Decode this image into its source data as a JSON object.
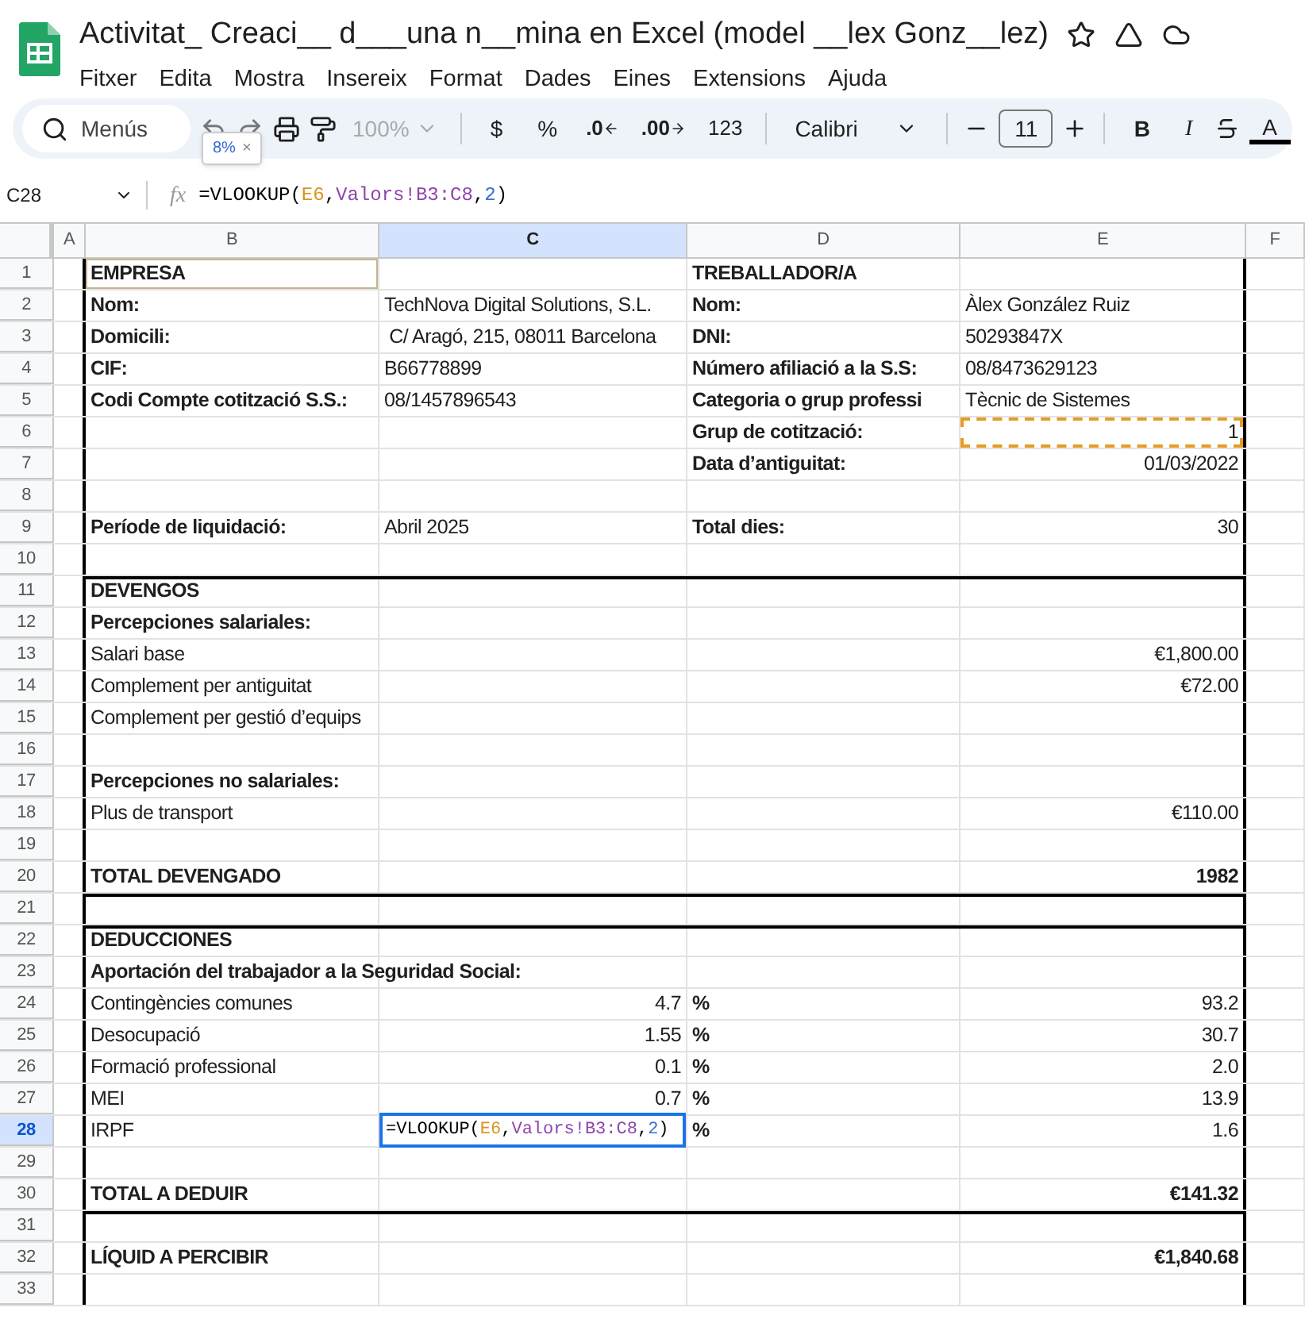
{
  "app": {
    "title": "Activitat_ Creaci__ d___una n__mina en Excel (model __lex Gonz__lez)",
    "menus": [
      "Fitxer",
      "Edita",
      "Mostra",
      "Insereix",
      "Format",
      "Dades",
      "Eines",
      "Extensions",
      "Ajuda"
    ]
  },
  "toolbar": {
    "search": "Menús",
    "zoom": "100%",
    "currency": "$",
    "percent": "%",
    "decrease_decimals": ".0",
    "increase_decimals": ".00",
    "number_format": "123",
    "font": "Calibri",
    "font_size": "11",
    "bold": "B",
    "italic": "I",
    "text_color": "A"
  },
  "tooltip": {
    "text": "8%",
    "close": "×"
  },
  "formula_bar": {
    "cell": "C28",
    "fx": "fx",
    "formula": [
      {
        "text": "=VLOOKUP(",
        "color": "#000000"
      },
      {
        "text": "E6",
        "color": "#d9951e"
      },
      {
        "text": ",",
        "color": "#000000"
      },
      {
        "text": "Valors!B3:C8",
        "color": "#8e44ad"
      },
      {
        "text": ",",
        "color": "#000000"
      },
      {
        "text": "2",
        "color": "#3b6fd4"
      },
      {
        "text": ")",
        "color": "#000000"
      }
    ]
  },
  "sheet": {
    "columns": [
      {
        "label": "A",
        "selected": false
      },
      {
        "label": "B",
        "selected": false
      },
      {
        "label": "C",
        "selected": true
      },
      {
        "label": "D",
        "selected": false
      },
      {
        "label": "E",
        "selected": false
      },
      {
        "label": "F",
        "selected": false
      }
    ],
    "rows": [
      {
        "number": "1",
        "selected": false,
        "rule_above": false,
        "cells": [
          {
            "text": ""
          },
          {
            "kind": "text",
            "text": "EMPRESA",
            "bold": true,
            "outlined": true
          },
          {
            "text": ""
          },
          {
            "kind": "text",
            "text": "TREBALLADOR/A",
            "bold": true
          }
        ]
      },
      {
        "number": "2",
        "selected": false,
        "rule_above": false,
        "cells": [
          {
            "text": ""
          },
          {
            "kind": "text",
            "text": "Nom:",
            "bold": true
          },
          {
            "kind": "text",
            "text": "TechNova Digital Solutions, S.L.",
            "bold": false
          },
          {
            "kind": "text",
            "text": "Nom:",
            "bold": true
          },
          {
            "kind": "text",
            "text": "Àlex González Ruiz",
            "bold": false
          }
        ]
      },
      {
        "number": "3",
        "selected": false,
        "rule_above": false,
        "cells": [
          {
            "text": ""
          },
          {
            "kind": "text",
            "text": "Domicili:",
            "bold": true
          },
          {
            "kind": "text",
            "text": " C/ Aragó, 215, 08011 Barcelona",
            "bold": false
          },
          {
            "kind": "text",
            "text": "DNI:",
            "bold": true
          },
          {
            "kind": "text",
            "text": "50293847X",
            "bold": false
          }
        ]
      },
      {
        "number": "4",
        "selected": false,
        "rule_above": false,
        "cells": [
          {
            "text": ""
          },
          {
            "kind": "text",
            "text": "CIF:",
            "bold": true
          },
          {
            "kind": "text",
            "text": "B66778899",
            "bold": false
          },
          {
            "kind": "text",
            "text": "Número afiliació a la S.S:",
            "bold": true
          },
          {
            "kind": "text",
            "text": "08/8473629123",
            "bold": false
          }
        ]
      },
      {
        "number": "5",
        "selected": false,
        "rule_above": false,
        "cells": [
          {
            "text": ""
          },
          {
            "kind": "text",
            "text": "Codi Compte cotització S.S.:",
            "bold": true
          },
          {
            "kind": "text",
            "text": "08/1457896543",
            "bold": false
          },
          {
            "kind": "text",
            "text": "Categoria o grup professi",
            "bold": true
          },
          {
            "kind": "text",
            "text": "Tècnic de Sistemes",
            "bold": false
          }
        ]
      },
      {
        "number": "6",
        "selected": false,
        "rule_above": false,
        "cells": [
          {
            "text": ""
          },
          {
            "text": ""
          },
          {
            "text": ""
          },
          {
            "kind": "text",
            "text": "Grup de cotització:",
            "bold": true
          },
          {
            "kind": "number",
            "text": "1",
            "bold": false,
            "referenced": true
          }
        ]
      },
      {
        "number": "7",
        "selected": false,
        "rule_above": false,
        "cells": [
          {
            "text": ""
          },
          {
            "text": ""
          },
          {
            "text": ""
          },
          {
            "kind": "text",
            "text": "Data d’antiguitat:",
            "bold": true
          },
          {
            "kind": "number",
            "text": "01/03/2022",
            "bold": false
          }
        ]
      },
      {
        "number": "8",
        "selected": false,
        "rule_above": false,
        "cells": []
      },
      {
        "number": "9",
        "selected": false,
        "rule_above": false,
        "cells": [
          {
            "text": ""
          },
          {
            "kind": "text",
            "text": "Període de liquidació:",
            "bold": true
          },
          {
            "kind": "text",
            "text": "Abril 2025",
            "bold": false
          },
          {
            "kind": "text",
            "text": "Total dies:",
            "bold": true
          },
          {
            "kind": "number",
            "text": "30",
            "bold": false
          }
        ]
      },
      {
        "number": "10",
        "selected": false,
        "rule_above": false,
        "cells": []
      },
      {
        "number": "11",
        "selected": false,
        "rule_above": true,
        "cells": [
          {
            "text": ""
          },
          {
            "kind": "text",
            "text": "DEVENGOS",
            "bold": true
          }
        ]
      },
      {
        "number": "12",
        "selected": false,
        "rule_above": false,
        "cells": [
          {
            "text": ""
          },
          {
            "kind": "text",
            "text": "Percepciones salariales:",
            "bold": true
          }
        ]
      },
      {
        "number": "13",
        "selected": false,
        "rule_above": false,
        "cells": [
          {
            "text": ""
          },
          {
            "kind": "text",
            "text": "Salari base",
            "bold": false
          },
          {
            "text": ""
          },
          {
            "text": ""
          },
          {
            "kind": "number",
            "text": "€1,800.00",
            "bold": false
          }
        ]
      },
      {
        "number": "14",
        "selected": false,
        "rule_above": false,
        "cells": [
          {
            "text": ""
          },
          {
            "kind": "text",
            "text": "Complement per antiguitat",
            "bold": false
          },
          {
            "text": ""
          },
          {
            "text": ""
          },
          {
            "kind": "number",
            "text": "€72.00",
            "bold": false
          }
        ]
      },
      {
        "number": "15",
        "selected": false,
        "rule_above": false,
        "cells": [
          {
            "text": ""
          },
          {
            "kind": "text",
            "text": "Complement per gestió d’equips",
            "bold": false
          }
        ]
      },
      {
        "number": "16",
        "selected": false,
        "rule_above": false,
        "cells": []
      },
      {
        "number": "17",
        "selected": false,
        "rule_above": false,
        "cells": [
          {
            "text": ""
          },
          {
            "kind": "text",
            "text": "Percepciones no salariales:",
            "bold": true
          }
        ]
      },
      {
        "number": "18",
        "selected": false,
        "rule_above": false,
        "cells": [
          {
            "text": ""
          },
          {
            "kind": "text",
            "text": "Plus de transport",
            "bold": false
          },
          {
            "text": ""
          },
          {
            "text": ""
          },
          {
            "kind": "number",
            "text": "€110.00",
            "bold": false
          }
        ]
      },
      {
        "number": "19",
        "selected": false,
        "rule_above": false,
        "cells": []
      },
      {
        "number": "20",
        "selected": false,
        "rule_above": false,
        "cells": [
          {
            "text": ""
          },
          {
            "kind": "text",
            "text": "TOTAL DEVENGADO",
            "bold": true
          },
          {
            "text": ""
          },
          {
            "text": ""
          },
          {
            "kind": "number",
            "text": "1982",
            "bold": true
          }
        ]
      },
      {
        "number": "21",
        "selected": false,
        "rule_above": true,
        "cells": []
      },
      {
        "number": "22",
        "selected": false,
        "rule_above": true,
        "cells": [
          {
            "text": ""
          },
          {
            "kind": "text",
            "text": "DEDUCCIONES",
            "bold": true
          }
        ]
      },
      {
        "number": "23",
        "selected": false,
        "rule_above": false,
        "cells": [
          {
            "text": ""
          },
          {
            "kind": "text",
            "text": "Aportación del trabajador a la Seguridad Social:",
            "bold": true
          }
        ]
      },
      {
        "number": "24",
        "selected": false,
        "rule_above": false,
        "cells": [
          {
            "text": ""
          },
          {
            "kind": "text",
            "text": "Contingències comunes",
            "bold": false
          },
          {
            "kind": "number",
            "text": "4.7",
            "bold": false
          },
          {
            "kind": "text",
            "text": "%",
            "bold": true
          },
          {
            "kind": "number",
            "text": "93.2",
            "bold": false
          }
        ]
      },
      {
        "number": "25",
        "selected": false,
        "rule_above": false,
        "cells": [
          {
            "text": ""
          },
          {
            "kind": "text",
            "text": "Desocupació",
            "bold": false
          },
          {
            "kind": "number",
            "text": "1.55",
            "bold": false
          },
          {
            "kind": "text",
            "text": "%",
            "bold": true
          },
          {
            "kind": "number",
            "text": "30.7",
            "bold": false
          }
        ]
      },
      {
        "number": "26",
        "selected": false,
        "rule_above": false,
        "cells": [
          {
            "text": ""
          },
          {
            "kind": "text",
            "text": "Formació professional",
            "bold": false
          },
          {
            "kind": "number",
            "text": "0.1",
            "bold": false
          },
          {
            "kind": "text",
            "text": "%",
            "bold": true
          },
          {
            "kind": "number",
            "text": "2.0",
            "bold": false
          }
        ]
      },
      {
        "number": "27",
        "selected": false,
        "rule_above": false,
        "cells": [
          {
            "text": ""
          },
          {
            "kind": "text",
            "text": "MEI",
            "bold": false
          },
          {
            "kind": "number",
            "text": "0.7",
            "bold": false
          },
          {
            "kind": "text",
            "text": "%",
            "bold": true
          },
          {
            "kind": "number",
            "text": "13.9",
            "bold": false
          }
        ]
      },
      {
        "number": "28",
        "selected": true,
        "rule_above": false,
        "cells": [
          {
            "text": ""
          },
          {
            "kind": "text",
            "text": "IRPF",
            "bold": false
          },
          {
            "kind": "editor",
            "formula": [
              {
                "text": "=VLOOKUP(",
                "color": "#000000"
              },
              {
                "text": "E6",
                "color": "#d9951e"
              },
              {
                "text": ",",
                "color": "#000000"
              },
              {
                "text": "Valors!B3:C8",
                "color": "#8e44ad"
              },
              {
                "text": ",",
                "color": "#000000"
              },
              {
                "text": "2",
                "color": "#3b6fd4"
              },
              {
                "text": ")",
                "color": "#000000"
              }
            ]
          },
          {
            "kind": "text",
            "text": "%",
            "bold": true
          },
          {
            "kind": "number",
            "text": "1.6",
            "bold": false
          }
        ]
      },
      {
        "number": "29",
        "selected": false,
        "rule_above": false,
        "cells": []
      },
      {
        "number": "30",
        "selected": false,
        "rule_above": false,
        "cells": [
          {
            "text": ""
          },
          {
            "kind": "text",
            "text": "TOTAL A DEDUIR",
            "bold": true
          },
          {
            "text": ""
          },
          {
            "text": ""
          },
          {
            "kind": "number",
            "text": "€141.32",
            "bold": true
          }
        ]
      },
      {
        "number": "31",
        "selected": false,
        "rule_above": true,
        "cells": []
      },
      {
        "number": "32",
        "selected": false,
        "rule_above": false,
        "cells": [
          {
            "text": ""
          },
          {
            "kind": "text",
            "text": "LÍQUID A PERCIBIR",
            "bold": true
          },
          {
            "text": ""
          },
          {
            "text": ""
          },
          {
            "kind": "number",
            "text": "€1,840.68",
            "bold": true
          }
        ]
      },
      {
        "number": "33",
        "selected": false,
        "rule_above": false,
        "cells": []
      }
    ]
  }
}
